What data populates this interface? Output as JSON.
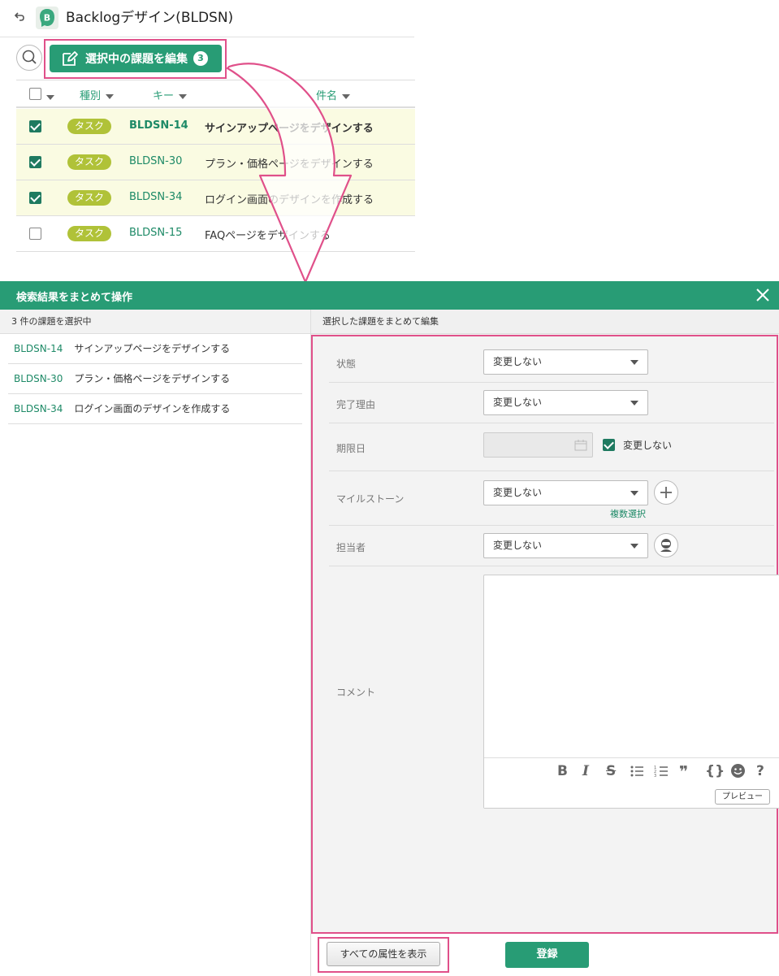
{
  "header": {
    "project_title": "Backlogデザイン(BLDSN)"
  },
  "toolbar": {
    "edit_selected_label": "選択中の課題を編集",
    "selected_count": "3"
  },
  "grid": {
    "columns": [
      "種別",
      "キー",
      "件名"
    ],
    "rows": [
      {
        "checked": true,
        "type": "タスク",
        "key": "BLDSN-14",
        "subject": "サインアップページをデザインする",
        "bold": true
      },
      {
        "checked": true,
        "type": "タスク",
        "key": "BLDSN-30",
        "subject": "プラン・価格ページをデザインする",
        "bold": false
      },
      {
        "checked": true,
        "type": "タスク",
        "key": "BLDSN-34",
        "subject": "ログイン画面のデザインを作成する",
        "bold": false
      },
      {
        "checked": false,
        "type": "タスク",
        "key": "BLDSN-15",
        "subject": "FAQページをデザインする",
        "bold": false
      }
    ]
  },
  "modal": {
    "title": "検索結果をまとめて操作",
    "left_header": "3 件の課題を選択中",
    "selected_issues": [
      {
        "key": "BLDSN-14",
        "subject": "サインアップページをデザインする"
      },
      {
        "key": "BLDSN-30",
        "subject": "プラン・価格ページをデザインする"
      },
      {
        "key": "BLDSN-34",
        "subject": "ログイン画面のデザインを作成する"
      }
    ],
    "right_header": "選択した課題をまとめて編集",
    "fields": {
      "status_label": "状態",
      "status_value": "変更しない",
      "resolution_label": "完了理由",
      "resolution_value": "変更しない",
      "due_label": "期限日",
      "due_nochange_label": "変更しない",
      "milestone_label": "マイルストーン",
      "milestone_value": "変更しない",
      "multi_select_label": "複数選択",
      "assignee_label": "担当者",
      "assignee_value": "変更しない",
      "comment_label": "コメント"
    },
    "editor": {
      "bold": "B",
      "italic": "I",
      "strike": "S",
      "quote": "❞",
      "code": "{}",
      "help": "?",
      "preview_label": "プレビュー"
    },
    "footer": {
      "show_all_label": "すべての属性を表示",
      "register_label": "登録"
    }
  },
  "colors": {
    "brand_green": "#289c75",
    "highlight_pink": "#e0508a",
    "task_tag": "#b0c238",
    "selected_row_bg": "#fafbe2"
  }
}
